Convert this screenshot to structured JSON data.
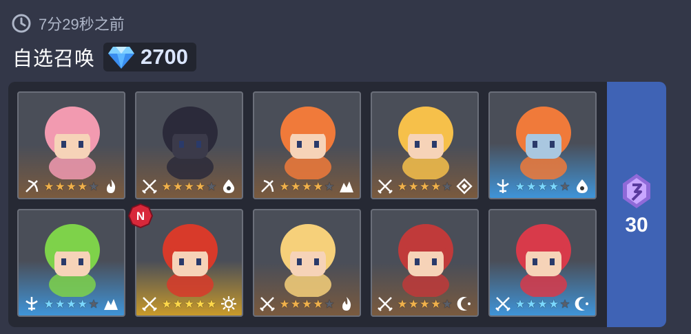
{
  "header": {
    "timestamp": "7分29秒之前",
    "title": "自选召唤",
    "gem_count": "2700"
  },
  "side_tab": {
    "ticket_count": "30"
  },
  "colors": {
    "rare": "#7a5a3e",
    "epic": "#3f94d8",
    "legend": "#c99a2a",
    "tab": "#3f63b5"
  },
  "heroes": [
    {
      "slot": "hero-1",
      "rarity": "rare",
      "stars": 4,
      "class_icon": "bow-class-icon",
      "element_icon": "fire-element-icon",
      "is_new": false,
      "hair": "#f29ab0",
      "skin": "#f6d3b8"
    },
    {
      "slot": "hero-2",
      "rarity": "rare",
      "stars": 4,
      "class_icon": "sword-class-icon",
      "element_icon": "water-element-icon",
      "is_new": false,
      "hair": "#2b2a3a",
      "skin": "#3b3a4a"
    },
    {
      "slot": "hero-3",
      "rarity": "rare",
      "stars": 4,
      "class_icon": "bow-class-icon",
      "element_icon": "earth-element-icon",
      "is_new": false,
      "hair": "#f07a3a",
      "skin": "#f6d3b8"
    },
    {
      "slot": "hero-4",
      "rarity": "rare",
      "stars": 4,
      "class_icon": "sword-class-icon",
      "element_icon": "basic-element-icon",
      "is_new": false,
      "hair": "#f6c04a",
      "skin": "#f6d3b8"
    },
    {
      "slot": "hero-5",
      "rarity": "epic",
      "stars": 4,
      "class_icon": "support-class-icon",
      "element_icon": "water-element-icon",
      "is_new": false,
      "hair": "#f07a3a",
      "skin": "#a9c7e0"
    },
    {
      "slot": "hero-6",
      "rarity": "epic",
      "stars": 4,
      "class_icon": "support-class-icon",
      "element_icon": "earth-element-icon",
      "is_new": false,
      "hair": "#7ed24a",
      "skin": "#f6d3b8"
    },
    {
      "slot": "hero-7",
      "rarity": "legend",
      "stars": 5,
      "class_icon": "sword-class-icon",
      "element_icon": "light-element-icon",
      "is_new": true,
      "hair": "#d83a2a",
      "skin": "#f6d3b8"
    },
    {
      "slot": "hero-8",
      "rarity": "rare",
      "stars": 4,
      "class_icon": "sword-class-icon",
      "element_icon": "fire-element-icon",
      "is_new": false,
      "hair": "#f6d07a",
      "skin": "#f6d3b8"
    },
    {
      "slot": "hero-9",
      "rarity": "rare",
      "stars": 4,
      "class_icon": "sword-class-icon",
      "element_icon": "dark-element-icon",
      "is_new": false,
      "hair": "#c03a3a",
      "skin": "#f6d3b8"
    },
    {
      "slot": "hero-10",
      "rarity": "epic",
      "stars": 4,
      "class_icon": "sword-class-icon",
      "element_icon": "dark-element-icon",
      "is_new": false,
      "hair": "#d83a4a",
      "skin": "#f6d3b8"
    }
  ],
  "new_badge_label": "N"
}
